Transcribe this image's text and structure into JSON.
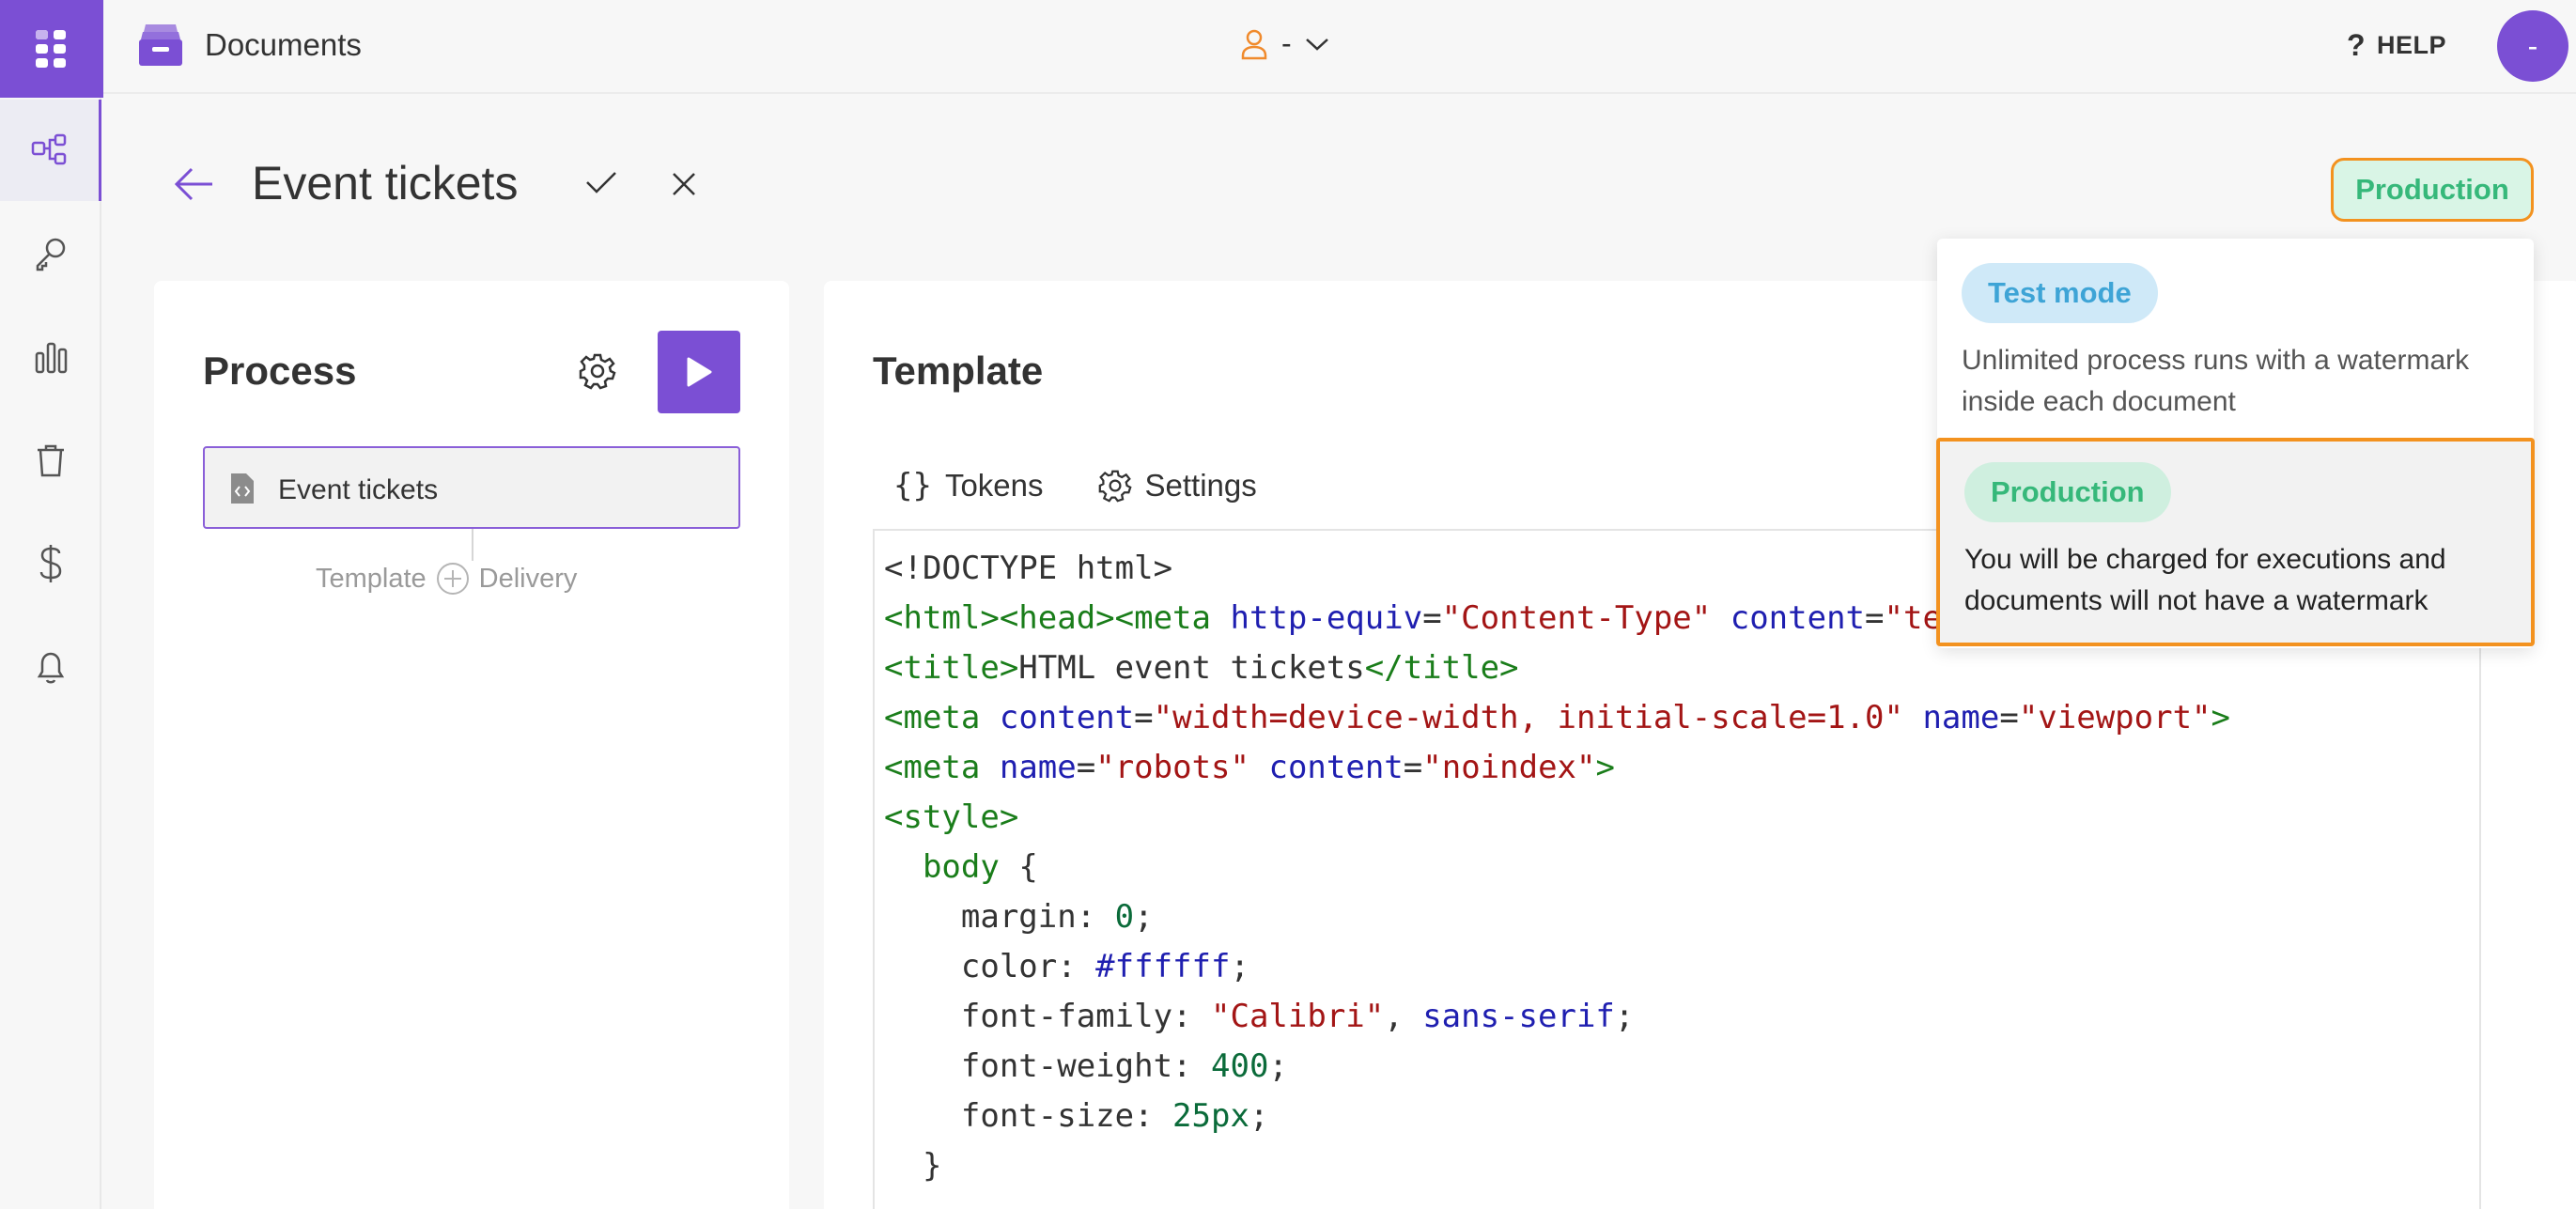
{
  "app": {
    "name": "Documents"
  },
  "header": {
    "user_label": "-",
    "help_label": "HELP",
    "avatar_initial": "-"
  },
  "sidebar": {
    "items": [
      {
        "icon": "workflow-icon",
        "active": true
      },
      {
        "icon": "key-icon",
        "active": false
      },
      {
        "icon": "bar-chart-icon",
        "active": false
      },
      {
        "icon": "trash-icon",
        "active": false
      },
      {
        "icon": "dollar-icon",
        "active": false
      },
      {
        "icon": "bell-icon",
        "active": false
      }
    ]
  },
  "page": {
    "title": "Event tickets",
    "environment": "Production"
  },
  "process": {
    "title": "Process",
    "step_label": "Event tickets",
    "add_before": "Template",
    "add_after": "Delivery"
  },
  "template": {
    "title": "Template",
    "tabs": [
      {
        "label": "Tokens",
        "icon": "braces-icon"
      },
      {
        "label": "Settings",
        "icon": "gear-icon"
      }
    ]
  },
  "env_menu": {
    "options": [
      {
        "label": "Test mode",
        "description": "Unlimited process runs with a watermark inside each document",
        "selected": false
      },
      {
        "label": "Production",
        "description": "You will be charged for executions and documents will not have a watermark",
        "selected": true
      }
    ]
  },
  "colors": {
    "accent": "#7b4fd4",
    "production": "#36b87a",
    "test": "#3ea4d6",
    "highlight": "#f3921f"
  }
}
